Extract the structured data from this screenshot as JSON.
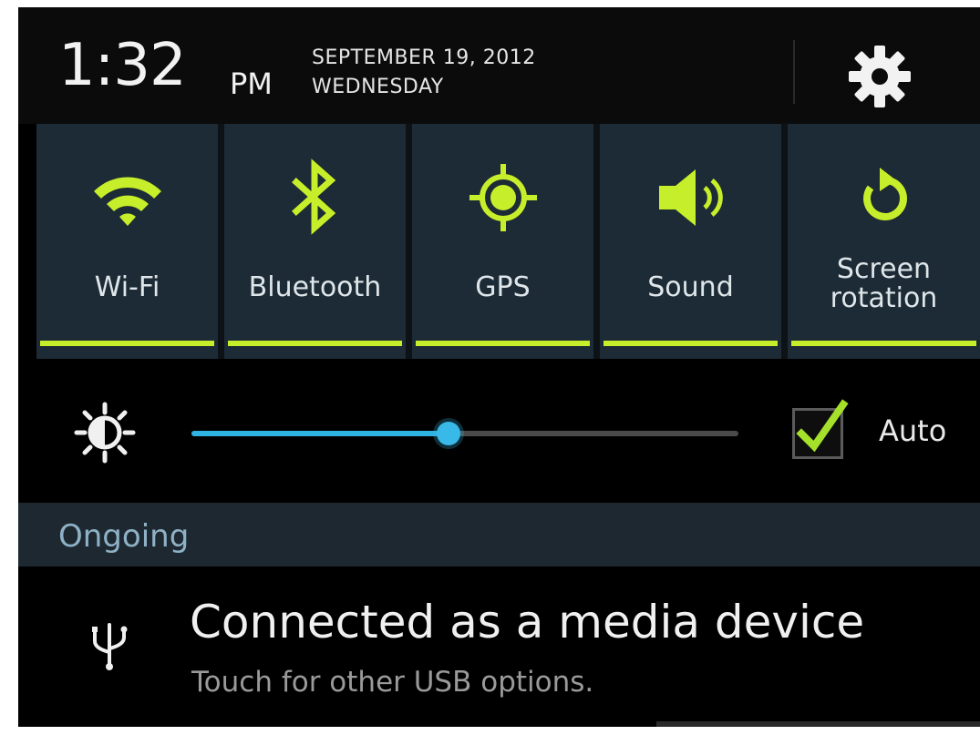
{
  "header": {
    "time": "1:32",
    "ampm": "PM",
    "date": "SEPTEMBER 19, 2012",
    "day": "WEDNESDAY"
  },
  "toggles": [
    {
      "label": "Wi-Fi",
      "icon": "wifi-icon",
      "active": true
    },
    {
      "label": "Bluetooth",
      "icon": "bluetooth-icon",
      "active": true
    },
    {
      "label": "GPS",
      "icon": "gps-icon",
      "active": true
    },
    {
      "label": "Sound",
      "icon": "sound-icon",
      "active": true
    },
    {
      "label": "Screen rotation",
      "icon": "screen-rotation-icon",
      "active": true
    }
  ],
  "brightness": {
    "level": 0.47,
    "auto_label": "Auto",
    "auto_checked": true
  },
  "ongoing": {
    "label": "Ongoing"
  },
  "notification": {
    "title": "Connected as a media device",
    "subtitle": "Touch for other USB options.",
    "icon": "usb-icon"
  },
  "colors": {
    "accent_green": "#c7ee2a",
    "slider_blue": "#2fb3e3",
    "tile_bg": "#1c2b35"
  }
}
